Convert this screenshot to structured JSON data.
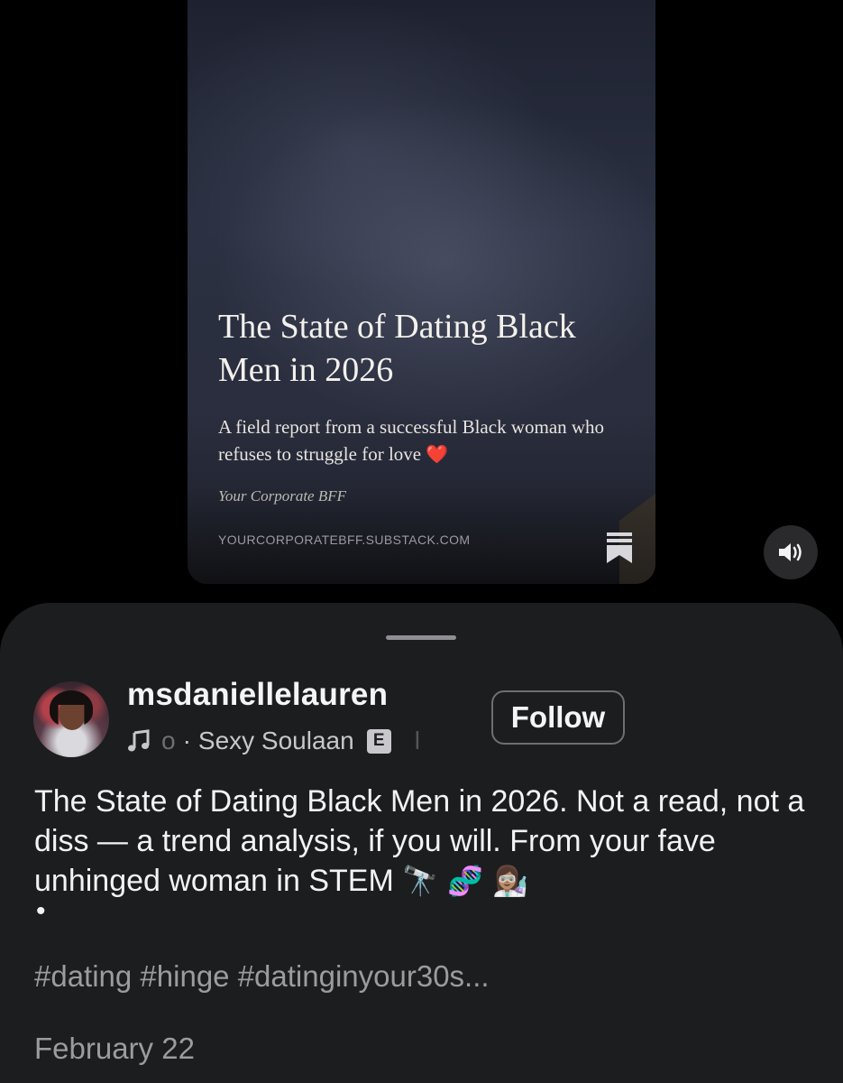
{
  "preview": {
    "title": "The State of Dating Black Men in 2026",
    "subtitle": "A field report from a successful Black woman who refuses to struggle for love",
    "subtitle_emoji": "❤️",
    "author": "Your Corporate BFF",
    "domain": "YOURCORPORATEBFF.SUBSTACK.COM",
    "bookmark_icon": "bookmark-icon"
  },
  "volume": {
    "icon": "speaker-icon"
  },
  "post": {
    "username": "msdaniellelauren",
    "music": {
      "icon": "music-note-icon",
      "fade_text": "o",
      "separator": "·",
      "song": "Sexy Soulaan",
      "explicit_badge": "E",
      "tail": "l"
    },
    "follow_label": "Follow",
    "caption": "The State of Dating Black Men in 2026. Not a read, not a diss — a trend analysis, if you will. From your fave unhinged woman in STEM ",
    "caption_emojis": "🔭 🧬 👩🏽‍🔬",
    "bullet": "•",
    "hashtags": "#dating #hinge #datinginyour30s...",
    "date": "February 22"
  },
  "colors": {
    "background": "#000000",
    "sheet": "#1c1d1f",
    "secondary_text": "#9b9ba0",
    "heart": "#e0313c"
  }
}
